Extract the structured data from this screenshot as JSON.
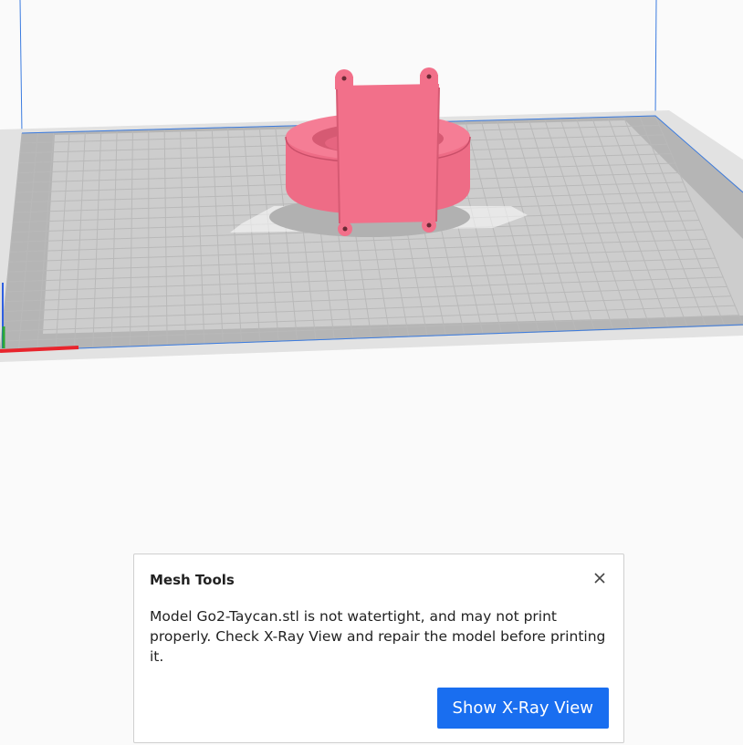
{
  "viewport": {
    "background_color": "#fafafa",
    "bed_color": "#cfcfcf",
    "bed_border_color": "#a9a9a9",
    "grid_color": "#b8b8b8",
    "volume_edge_color": "#3a7be0",
    "model_color": "#f2708a",
    "model_shadow_color": "#d85c75",
    "axis_x_color": "#e8242c",
    "axis_y_color": "#2aa836",
    "axis_z_color": "#2f5fe0"
  },
  "notification": {
    "title": "Mesh Tools",
    "message": "Model Go2-Taycan.stl is not watertight, and may not print properly. Check X-Ray View and repair the model before printing it.",
    "action_label": "Show X-Ray View",
    "close_icon": "close-icon",
    "accent_color": "#196ef0"
  }
}
